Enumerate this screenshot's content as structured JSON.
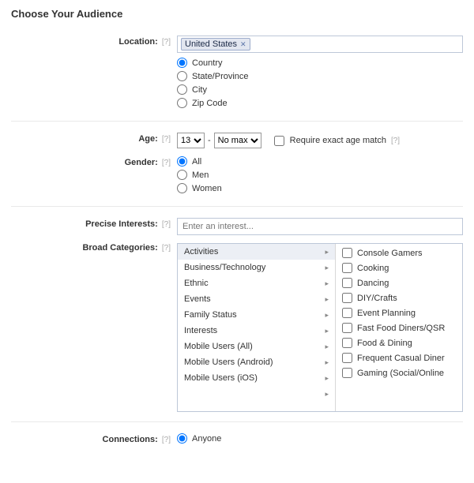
{
  "title": "Choose Your Audience",
  "help_glyph": "[?]",
  "location": {
    "label": "Location:",
    "token": "United States",
    "options": [
      "Country",
      "State/Province",
      "City",
      "Zip Code"
    ],
    "selected": 0
  },
  "age": {
    "label": "Age:",
    "min": "13",
    "max": "No max",
    "dash": "-",
    "require_label": "Require exact age match"
  },
  "gender": {
    "label": "Gender:",
    "options": [
      "All",
      "Men",
      "Women"
    ],
    "selected": 0
  },
  "precise": {
    "label": "Precise Interests:",
    "placeholder": "Enter an interest..."
  },
  "broad": {
    "label": "Broad Categories:",
    "categories": [
      "Activities",
      "Business/Technology",
      "Ethnic",
      "Events",
      "Family Status",
      "Interests",
      "Mobile Users (All)",
      "Mobile Users (Android)",
      "Mobile Users (iOS)"
    ],
    "selected": 0,
    "subcategories": [
      "Console Gamers",
      "Cooking",
      "Dancing",
      "DIY/Crafts",
      "Event Planning",
      "Fast Food Diners/QSR",
      "Food & Dining",
      "Frequent Casual Diner",
      "Gaming (Social/Online"
    ]
  },
  "connections": {
    "label": "Connections:",
    "option": "Anyone"
  }
}
